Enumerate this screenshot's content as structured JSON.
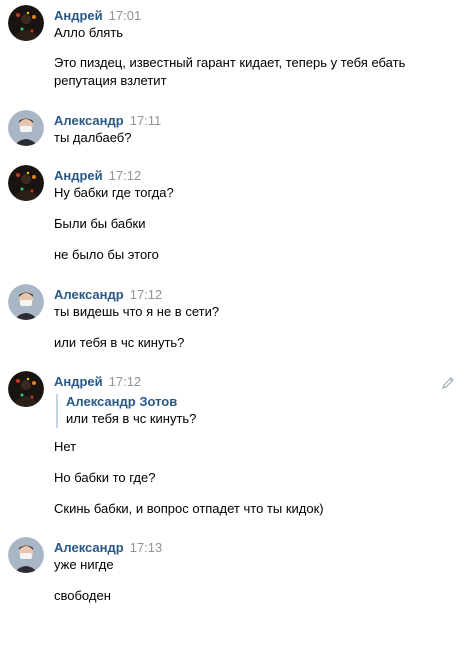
{
  "messages": [
    {
      "author": "Андрей",
      "time": "17:01",
      "avatar": "andrey-avatar",
      "lines": [
        "Алло блять",
        "Это пиздец, известный гарант кидает, теперь у тебя ебать",
        "репутация взлетит"
      ]
    },
    {
      "author": "Александр",
      "time": "17:11",
      "avatar": "alexandr-avatar",
      "lines": [
        "ты далбаеб?"
      ]
    },
    {
      "author": "Андрей",
      "time": "17:12",
      "avatar": "andrey-avatar",
      "lines": [
        "Ну бабки где тогда?",
        "Были бы бабки",
        "не было бы этого"
      ]
    },
    {
      "author": "Александр",
      "time": "17:12",
      "avatar": "alexandr-avatar",
      "lines": [
        "ты видешь что я не в сети?",
        "или тебя в чс кинуть?"
      ]
    },
    {
      "author": "Андрей",
      "time": "17:12",
      "avatar": "andrey-avatar",
      "quote": {
        "author": "Александр Зотов",
        "text": "или тебя в чс кинуть?"
      },
      "lines": [
        "Нет",
        "Но бабки то где?",
        "Скинь бабки, и вопрос отпадет что ты кидок)"
      ]
    },
    {
      "author": "Александр",
      "time": "17:13",
      "avatar": "alexandr-avatar",
      "lines": [
        "уже нигде",
        "свободен"
      ]
    }
  ],
  "icons": {
    "edit": "pencil-icon"
  },
  "colors": {
    "author": "#2a5885",
    "time": "#939393",
    "text": "#000000",
    "quote_border": "#c5d3e2"
  }
}
